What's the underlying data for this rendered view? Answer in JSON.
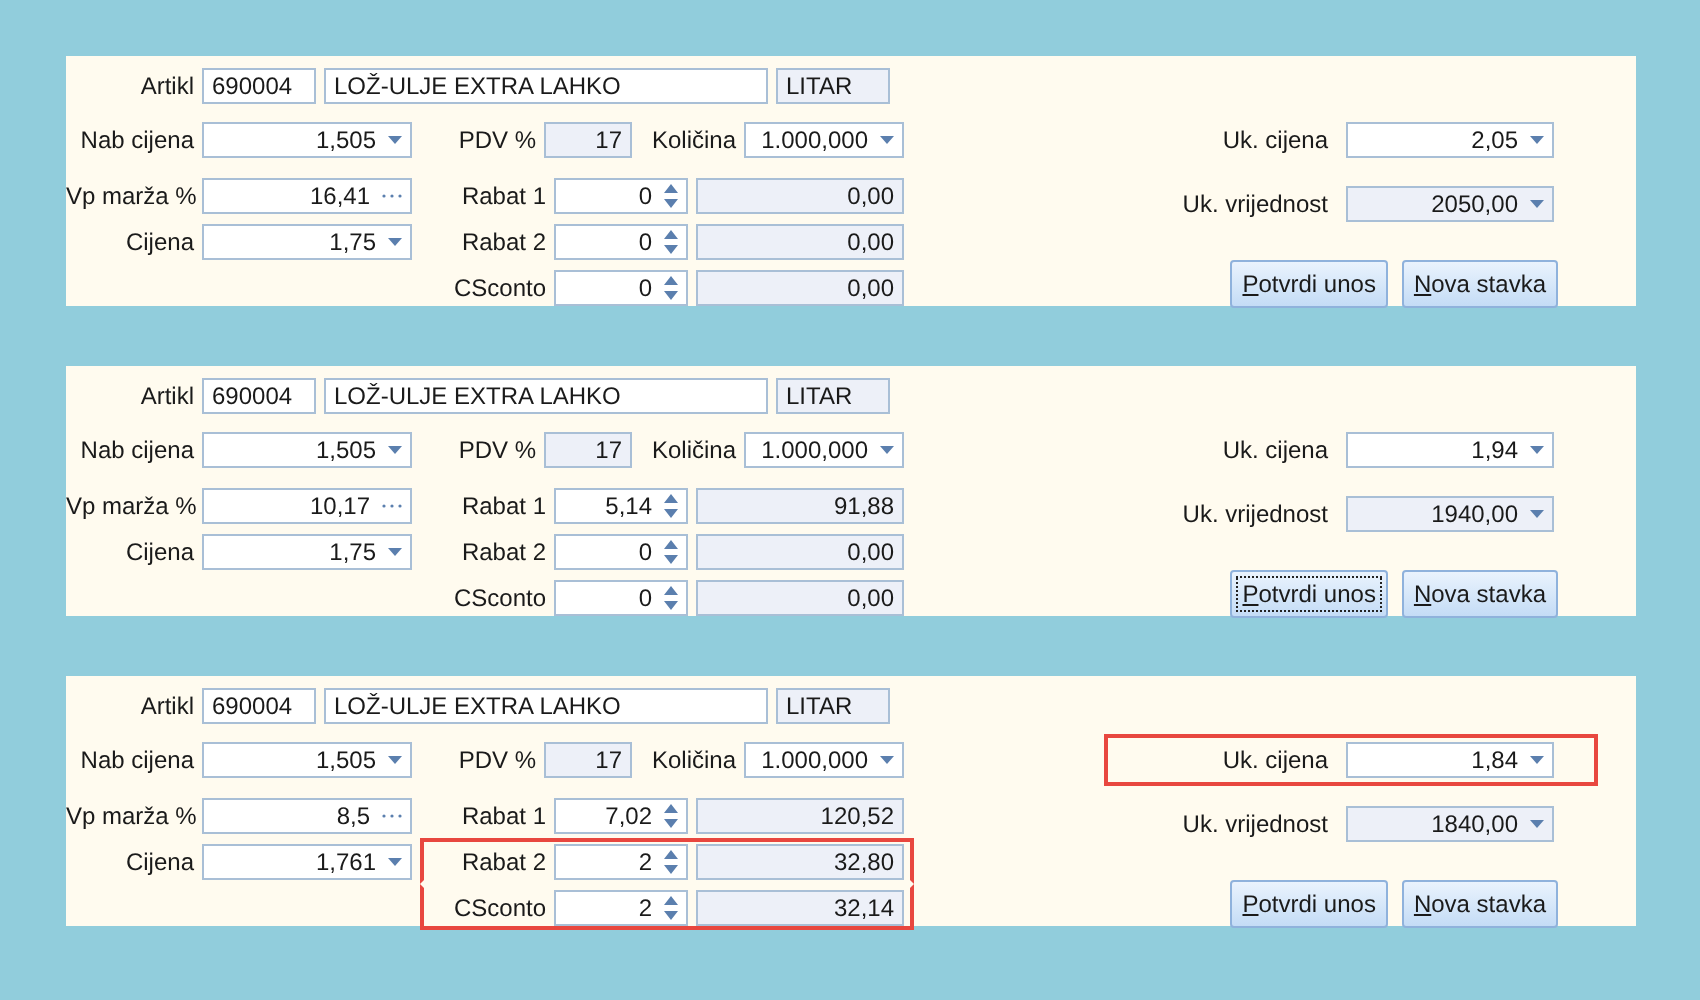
{
  "panels": [
    {
      "artikl": {
        "label": "Artikl",
        "code": "690004",
        "name": "LOŽ-ULJE EXTRA LAHKO",
        "unit": "LITAR"
      },
      "nab_cijena": {
        "label": "Nab cijena",
        "value": "1,505"
      },
      "pdv": {
        "label": "PDV %",
        "value": "17"
      },
      "kolicina": {
        "label": "Količina",
        "value": "1.000,000"
      },
      "vp_marza": {
        "label": "Vp marža %",
        "value": "16,41"
      },
      "cijena": {
        "label": "Cijena",
        "value": "1,75"
      },
      "rabati": [
        {
          "label": "Rabat 1",
          "value": "0",
          "amount": "0,00",
          "highlighted": false
        },
        {
          "label": "Rabat 2",
          "value": "0",
          "amount": "0,00",
          "highlighted": false
        },
        {
          "label": "CSconto",
          "value": "0",
          "amount": "0,00",
          "highlighted": false
        }
      ],
      "uk_cijena": {
        "label": "Uk. cijena",
        "value": "2,05",
        "highlighted": false
      },
      "uk_vrijednost": {
        "label": "Uk. vrijednost",
        "value": "2050,00"
      },
      "buttons": [
        {
          "label": "Potvrdi unos",
          "focused": false
        },
        {
          "label": "Nova stavka",
          "focused": false
        }
      ]
    },
    {
      "artikl": {
        "label": "Artikl",
        "code": "690004",
        "name": "LOŽ-ULJE EXTRA LAHKO",
        "unit": "LITAR"
      },
      "nab_cijena": {
        "label": "Nab cijena",
        "value": "1,505"
      },
      "pdv": {
        "label": "PDV %",
        "value": "17"
      },
      "kolicina": {
        "label": "Količina",
        "value": "1.000,000"
      },
      "vp_marza": {
        "label": "Vp marža %",
        "value": "10,17"
      },
      "cijena": {
        "label": "Cijena",
        "value": "1,75"
      },
      "rabati": [
        {
          "label": "Rabat 1",
          "value": "5,14",
          "amount": "91,88",
          "highlighted": false
        },
        {
          "label": "Rabat 2",
          "value": "0",
          "amount": "0,00",
          "highlighted": false
        },
        {
          "label": "CSconto",
          "value": "0",
          "amount": "0,00",
          "highlighted": false
        }
      ],
      "uk_cijena": {
        "label": "Uk. cijena",
        "value": "1,94",
        "highlighted": false
      },
      "uk_vrijednost": {
        "label": "Uk. vrijednost",
        "value": "1940,00"
      },
      "buttons": [
        {
          "label": "Potvrdi unos",
          "focused": true
        },
        {
          "label": "Nova stavka",
          "focused": false
        }
      ]
    },
    {
      "artikl": {
        "label": "Artikl",
        "code": "690004",
        "name": "LOŽ-ULJE EXTRA LAHKO",
        "unit": "LITAR"
      },
      "nab_cijena": {
        "label": "Nab cijena",
        "value": "1,505"
      },
      "pdv": {
        "label": "PDV %",
        "value": "17"
      },
      "kolicina": {
        "label": "Količina",
        "value": "1.000,000"
      },
      "vp_marza": {
        "label": "Vp marža %",
        "value": "8,5"
      },
      "cijena": {
        "label": "Cijena",
        "value": "1,761"
      },
      "rabati": [
        {
          "label": "Rabat 1",
          "value": "7,02",
          "amount": "120,52",
          "highlighted": false
        },
        {
          "label": "Rabat 2",
          "value": "2",
          "amount": "32,80",
          "highlighted": true
        },
        {
          "label": "CSconto",
          "value": "2",
          "amount": "32,14",
          "highlighted": true
        }
      ],
      "uk_cijena": {
        "label": "Uk. cijena",
        "value": "1,84",
        "highlighted": true
      },
      "uk_vrijednost": {
        "label": "Uk. vrijednost",
        "value": "1840,00"
      },
      "buttons": [
        {
          "label": "Potvrdi unos",
          "focused": false
        },
        {
          "label": "Nova stavka",
          "focused": false
        }
      ]
    }
  ]
}
